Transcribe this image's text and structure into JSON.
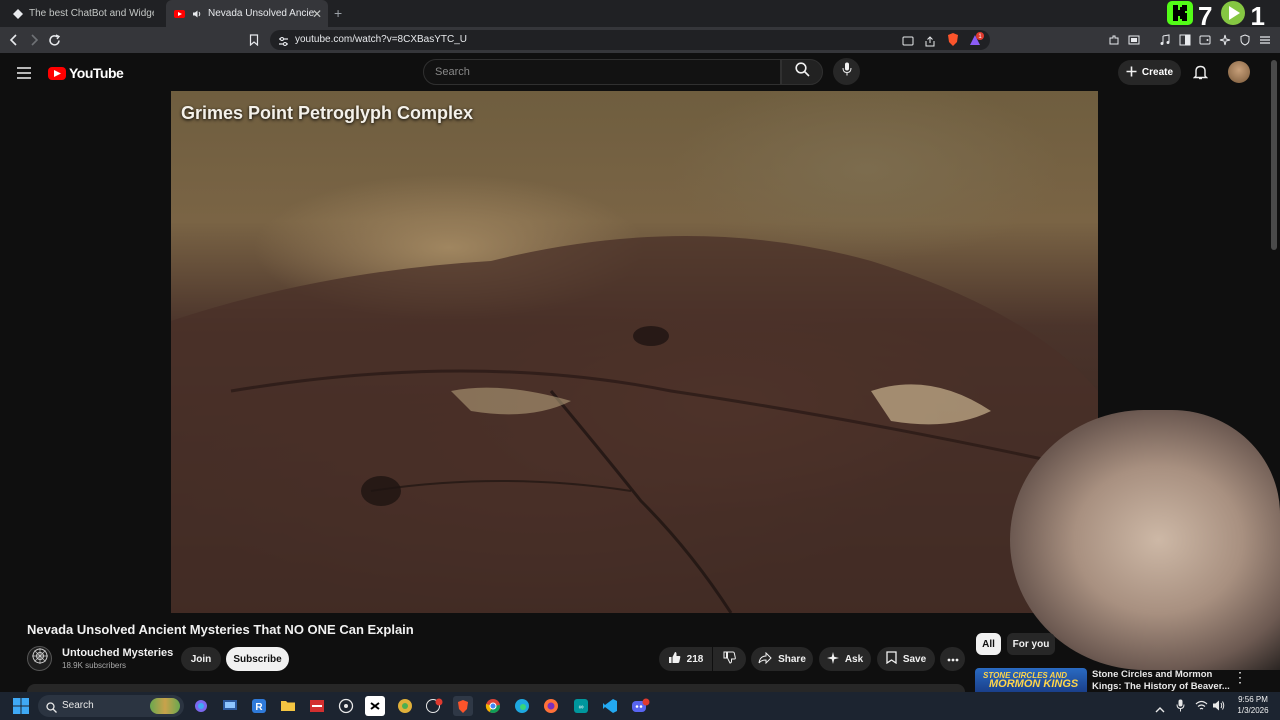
{
  "browser": {
    "tabs": [
      {
        "title": "The best ChatBot and Widgets for Ki",
        "active": false
      },
      {
        "title": "Nevada Unsolved Ancient My",
        "active": true
      }
    ],
    "new_tab": "+",
    "url": "youtube.com/watch?v=8CXBasYTC_U",
    "notification_count": "1"
  },
  "overlay": {
    "counter_a": "7",
    "counter_b": "1"
  },
  "youtube": {
    "logo_text": "YouTube",
    "search_placeholder": "Search",
    "create_label": "Create",
    "video_overlay_text": "Grimes Point Petroglyph Complex",
    "video_title": "Nevada Unsolved Ancient Mysteries That NO ONE Can Explain",
    "channel": {
      "name": "Untouched Mysteries",
      "subscribers": "18.9K subscribers"
    },
    "join_label": "Join",
    "subscribe_label": "Subscribe",
    "likes": "218",
    "share_label": "Share",
    "ask_label": "Ask",
    "save_label": "Save",
    "chips": [
      "All",
      "For you"
    ],
    "recommendation": {
      "thumb_top": "STONE CIRCLES AND",
      "thumb_main": "MORMON KINGS",
      "title": "Stone Circles and Mormon Kings: The History of Beaver..."
    }
  },
  "taskbar": {
    "search_label": "Search",
    "time": "9:56 PM",
    "date": "1/3/2026"
  },
  "colors": {
    "accent_red": "#ff0000",
    "kick_green": "#53fc18"
  }
}
